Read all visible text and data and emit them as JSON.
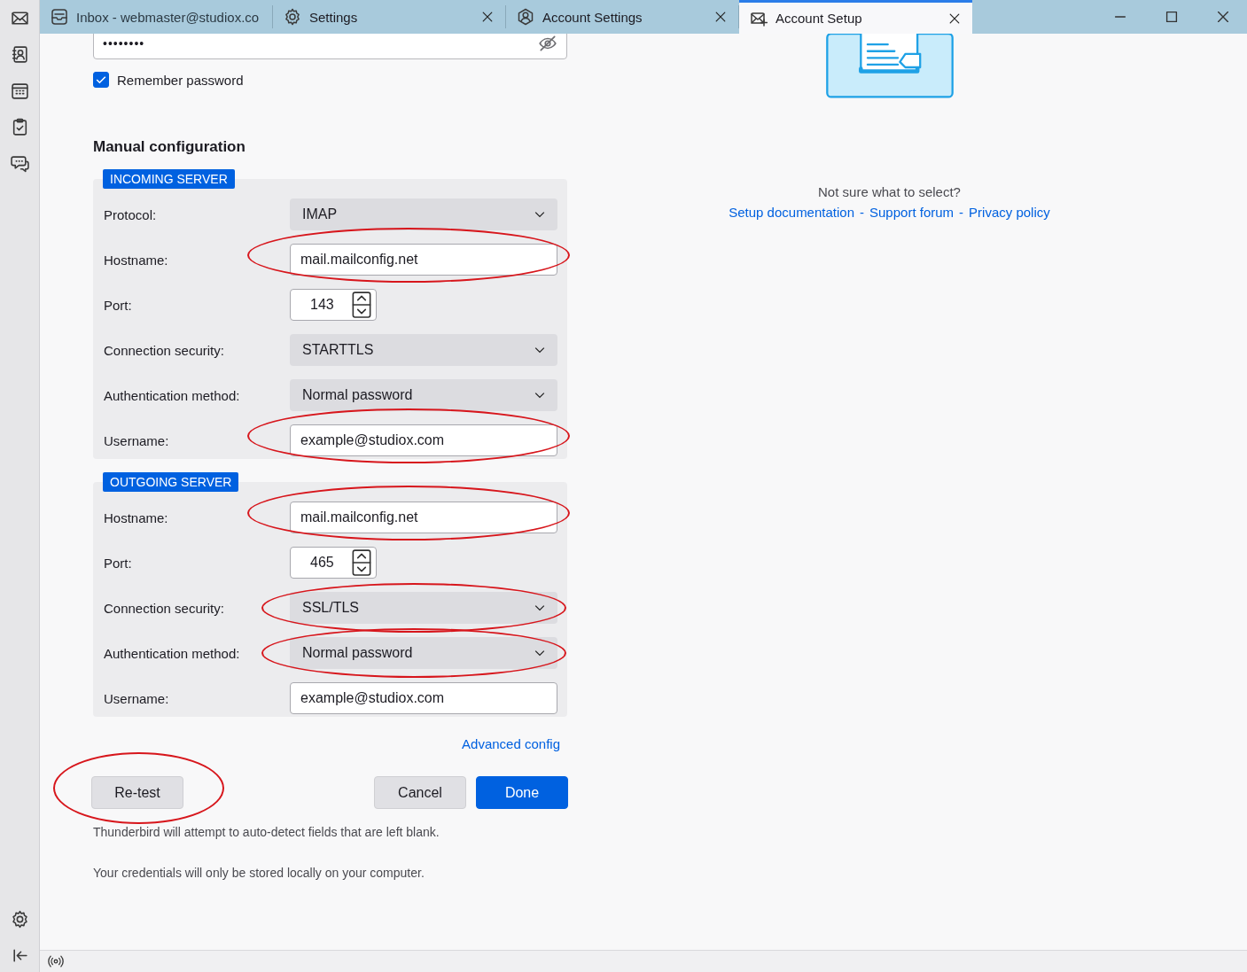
{
  "tabs": [
    {
      "label": "Inbox - webmaster@studiox.co",
      "selected": false,
      "closable": false
    },
    {
      "label": "Settings",
      "selected": false,
      "closable": true
    },
    {
      "label": "Account Settings",
      "selected": false,
      "closable": true
    },
    {
      "label": "Account Setup",
      "selected": true,
      "closable": true
    }
  ],
  "password": {
    "value": "••••••••"
  },
  "remember_password": {
    "label": "Remember password",
    "checked": true
  },
  "manual_heading": "Manual configuration",
  "servers": [
    {
      "badge": "INCOMING SERVER",
      "fields": [
        {
          "label": "Protocol:",
          "kind": "select",
          "value": "IMAP",
          "highlighted": false
        },
        {
          "label": "Hostname:",
          "kind": "text",
          "value": "mail.mailconfig.net",
          "highlighted": true
        },
        {
          "label": "Port:",
          "kind": "number",
          "value": "143",
          "highlighted": false
        },
        {
          "label": "Connection security:",
          "kind": "select",
          "value": "STARTTLS",
          "highlighted": false
        },
        {
          "label": "Authentication method:",
          "kind": "select",
          "value": "Normal password",
          "highlighted": false
        },
        {
          "label": "Username:",
          "kind": "text",
          "value": "example@studiox.com",
          "highlighted": true
        }
      ]
    },
    {
      "badge": "OUTGOING SERVER",
      "fields": [
        {
          "label": "Hostname:",
          "kind": "text",
          "value": "mail.mailconfig.net",
          "highlighted": true
        },
        {
          "label": "Port:",
          "kind": "number",
          "value": "465",
          "highlighted": false
        },
        {
          "label": "Connection security:",
          "kind": "select",
          "value": "SSL/TLS",
          "highlighted": true
        },
        {
          "label": "Authentication method:",
          "kind": "select",
          "value": "Normal password",
          "highlighted": true
        },
        {
          "label": "Username:",
          "kind": "text",
          "value": "example@studiox.com",
          "highlighted": false
        }
      ]
    }
  ],
  "advanced_link": "Advanced config",
  "buttons": [
    {
      "label": "Re-test",
      "kind": "secondary",
      "highlighted": true
    },
    {
      "label": "Cancel",
      "kind": "secondary",
      "highlighted": false
    },
    {
      "label": "Done",
      "kind": "primary",
      "highlighted": false
    }
  ],
  "notes": [
    "Thunderbird will attempt to auto-detect fields that are left blank.",
    "Your credentials will only be stored locally on your computer."
  ],
  "help": {
    "question": "Not sure what to select?",
    "links": [
      "Setup documentation",
      "Support forum",
      "Privacy policy"
    ],
    "separator": "-"
  }
}
